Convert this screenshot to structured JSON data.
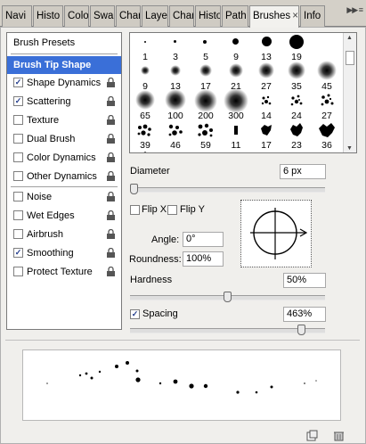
{
  "tabs": [
    {
      "label": "Navi"
    },
    {
      "label": "Histo"
    },
    {
      "label": "Colo"
    },
    {
      "label": "Swa"
    },
    {
      "label": "Char"
    },
    {
      "label": "Laye"
    },
    {
      "label": "Char"
    },
    {
      "label": "Histo"
    },
    {
      "label": "Path"
    },
    {
      "label": "Brushes",
      "close": "×"
    },
    {
      "label": "Info"
    }
  ],
  "menu_arrows": "▶▶ ≡",
  "options": {
    "brush_presets": "Brush Presets",
    "brush_tip_shape": "Brush Tip Shape",
    "shape_dynamics": {
      "label": "Shape Dynamics",
      "checked": "✓"
    },
    "scattering": {
      "label": "Scattering",
      "checked": "✓"
    },
    "texture": {
      "label": "Texture",
      "checked": ""
    },
    "dual_brush": {
      "label": "Dual Brush",
      "checked": ""
    },
    "color_dynamics": {
      "label": "Color Dynamics",
      "checked": ""
    },
    "other_dynamics": {
      "label": "Other Dynamics",
      "checked": ""
    },
    "noise": {
      "label": "Noise",
      "checked": ""
    },
    "wet_edges": {
      "label": "Wet Edges",
      "checked": ""
    },
    "airbrush": {
      "label": "Airbrush",
      "checked": ""
    },
    "smoothing": {
      "label": "Smoothing",
      "checked": "✓"
    },
    "protect_texture": {
      "label": "Protect Texture",
      "checked": ""
    }
  },
  "brush_sizes": [
    [
      "1",
      "3",
      "5",
      "9",
      "13",
      "19",
      "",
      ""
    ],
    [
      "9",
      "13",
      "17",
      "21",
      "27",
      "35",
      "45",
      ""
    ],
    [
      "65",
      "100",
      "200",
      "300",
      "14",
      "24",
      "27",
      ""
    ],
    [
      "39",
      "46",
      "59",
      "11",
      "17",
      "23",
      "36",
      ""
    ]
  ],
  "diameter": {
    "label": "Diameter",
    "value": "6 px"
  },
  "flip_x": {
    "label": "Flip X",
    "checked": ""
  },
  "flip_y": {
    "label": "Flip Y",
    "checked": ""
  },
  "angle": {
    "label": "Angle:",
    "value": "0°"
  },
  "roundness": {
    "label": "Roundness:",
    "value": "100%"
  },
  "hardness": {
    "label": "Hardness",
    "value": "50%"
  },
  "spacing": {
    "label": "Spacing",
    "value": "463%",
    "checked": "✓"
  },
  "colors": {
    "selection": "#3a6fd8",
    "panel": "#f0efec"
  }
}
